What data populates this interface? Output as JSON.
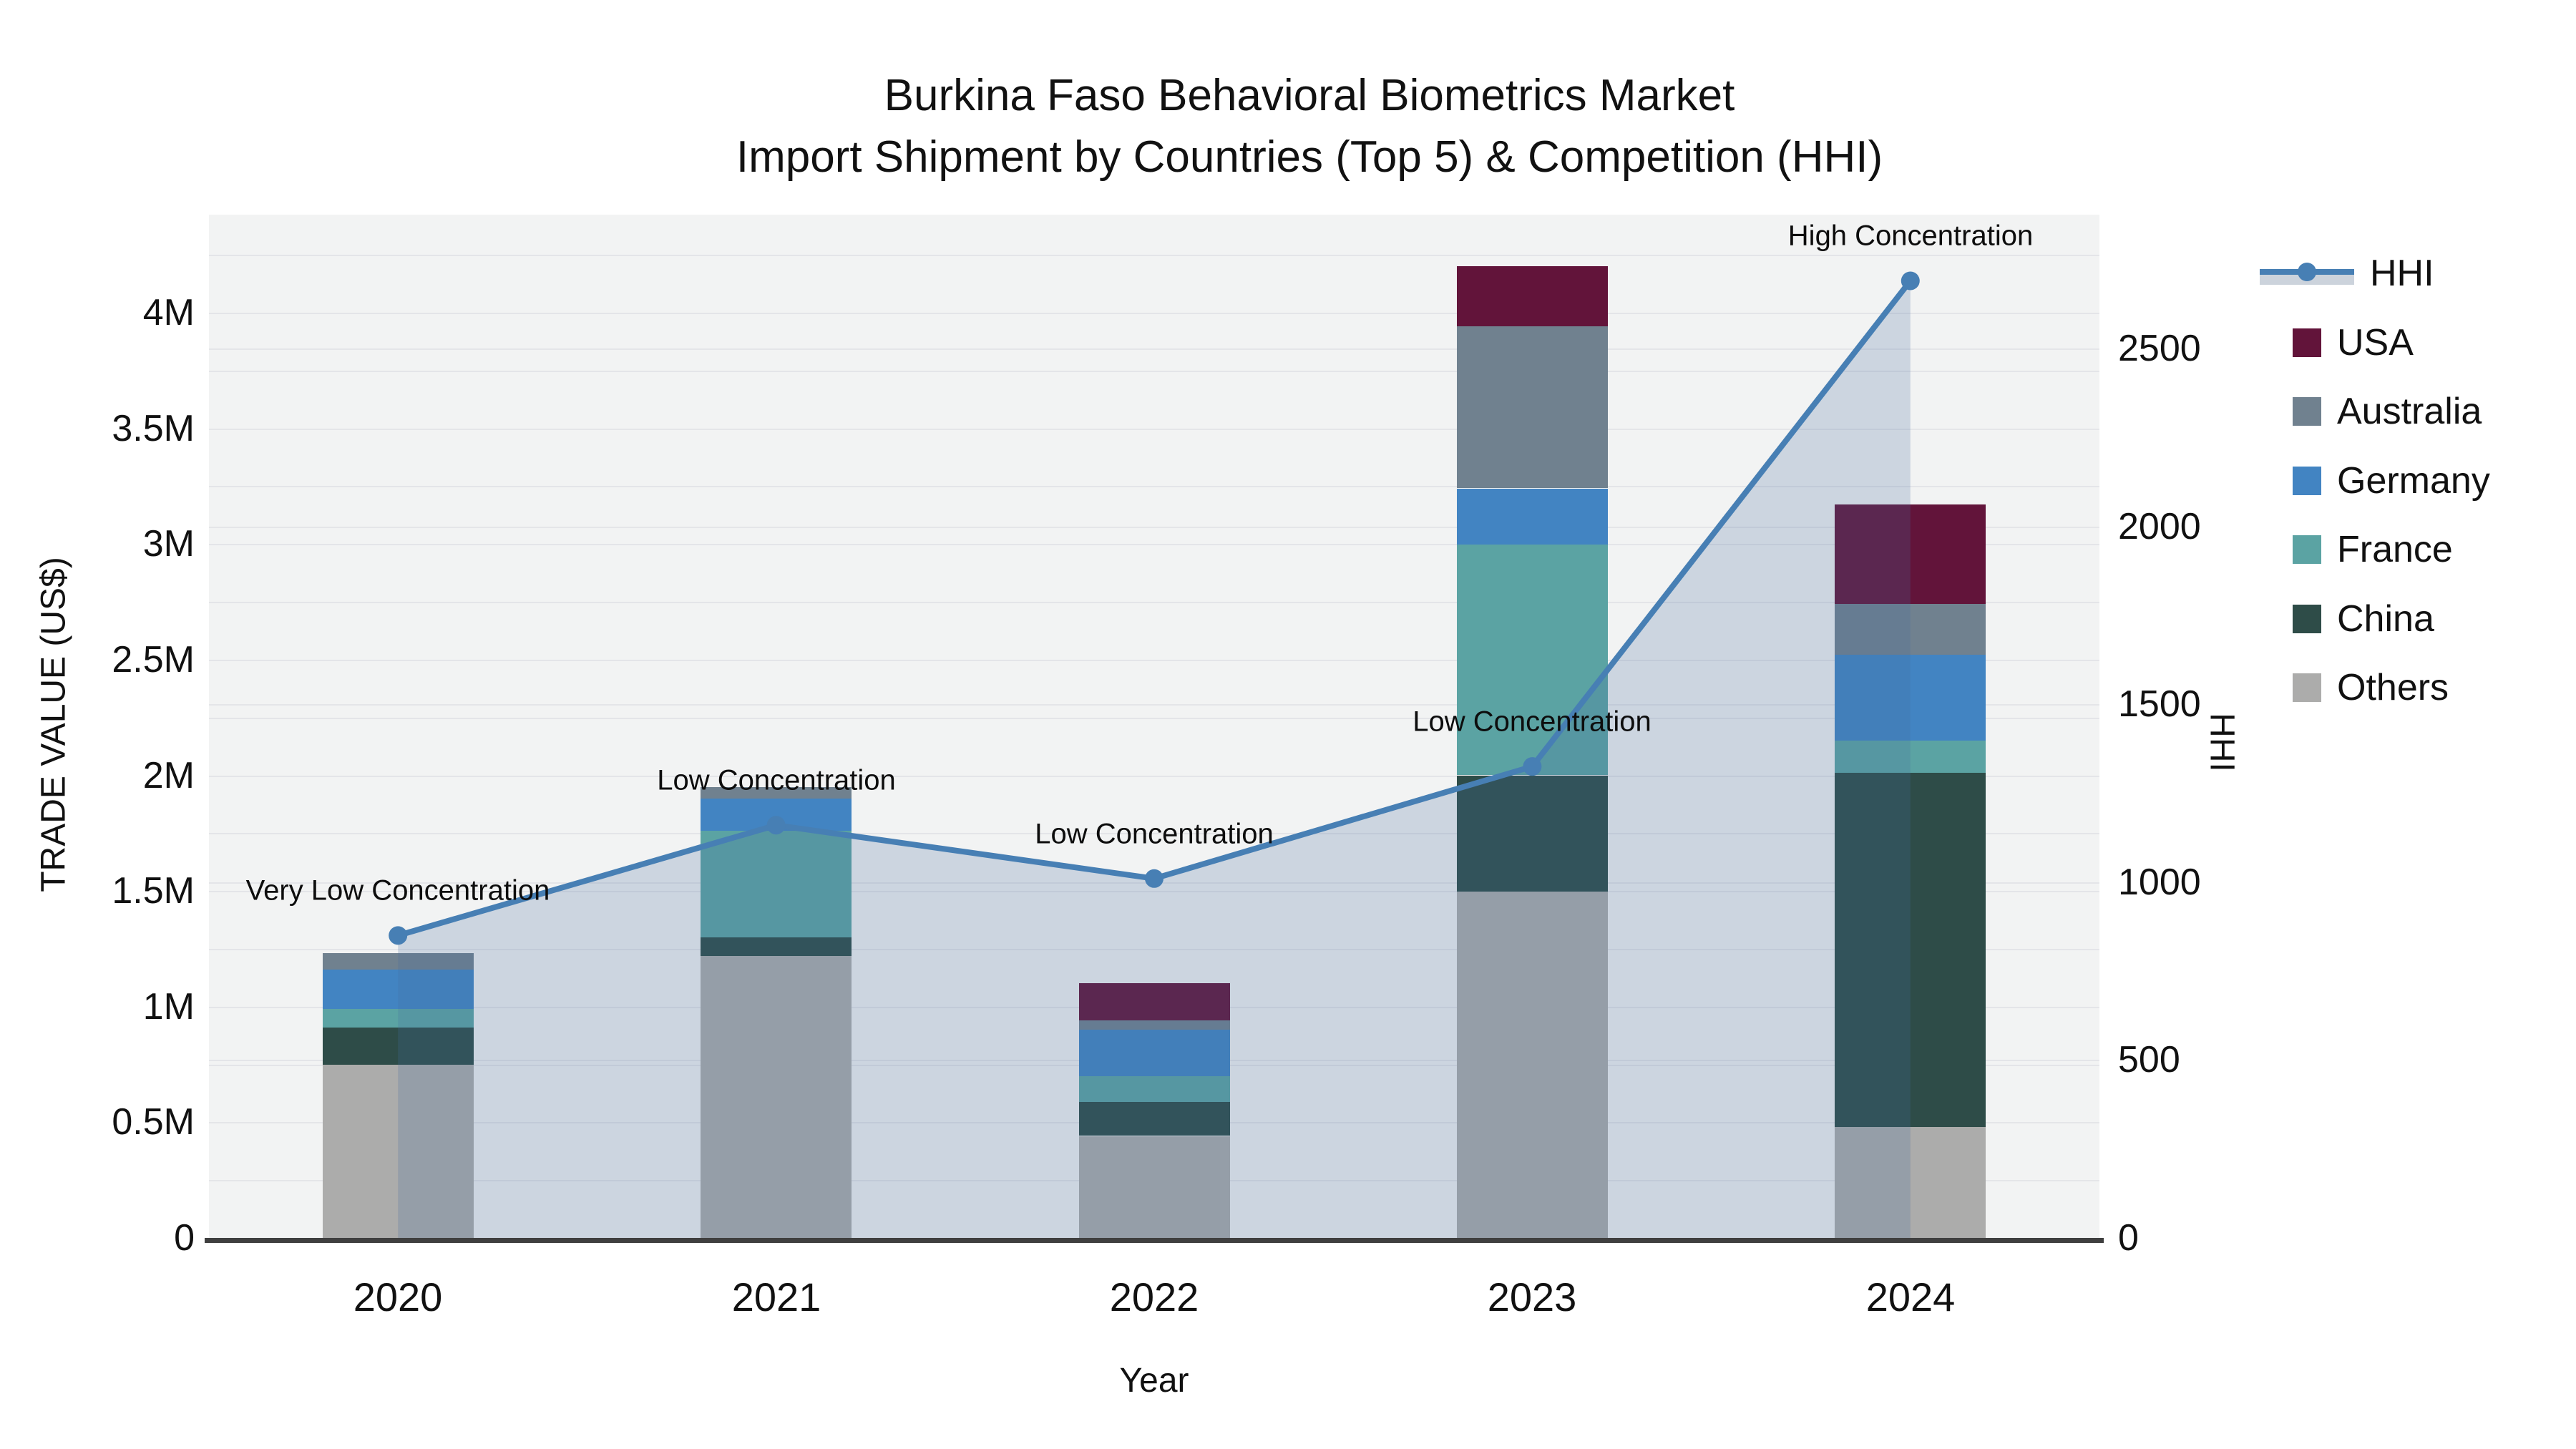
{
  "title_line1": "Burkina Faso Behavioral Biometrics Market",
  "title_line2": "Import Shipment by Countries (Top 5) & Competition (HHI)",
  "axes": {
    "x": {
      "title": "Year"
    },
    "y_left": {
      "title": "TRADE VALUE (US$)",
      "ticks": [
        "0",
        "0.5M",
        "1M",
        "1.5M",
        "2M",
        "2.5M",
        "3M",
        "3.5M",
        "4M"
      ],
      "tick_values_millions": [
        0,
        0.5,
        1,
        1.5,
        2,
        2.5,
        3,
        3.5,
        4
      ]
    },
    "y_right": {
      "title": "HHI",
      "ticks": [
        "0",
        "500",
        "1000",
        "1500",
        "2000",
        "2500"
      ],
      "tick_values": [
        0,
        500,
        1000,
        1500,
        2000,
        2500
      ]
    }
  },
  "legend": [
    {
      "label": "HHI",
      "type": "line",
      "color": "#477fb4"
    },
    {
      "label": "USA",
      "type": "swatch",
      "color": "#62143a"
    },
    {
      "label": "Australia",
      "type": "swatch",
      "color": "#70818f"
    },
    {
      "label": "Germany",
      "type": "swatch",
      "color": "#4284c2"
    },
    {
      "label": "France",
      "type": "swatch",
      "color": "#5ba3a3"
    },
    {
      "label": "China",
      "type": "swatch",
      "color": "#2e4c48"
    },
    {
      "label": "Others",
      "type": "swatch",
      "color": "#acacab"
    }
  ],
  "chart_data": {
    "type": "bar",
    "subtype": "stacked-bar-with-line-area",
    "categories": [
      "2020",
      "2021",
      "2022",
      "2023",
      "2024"
    ],
    "bar_value_unit": "trade value, US$ millions",
    "stack_order_bottom_to_top": [
      "Others",
      "China",
      "France",
      "Germany",
      "Australia",
      "USA"
    ],
    "series": [
      {
        "name": "USA",
        "color": "#62143a",
        "values": [
          0,
          0,
          0.16,
          0.26,
          0.43
        ]
      },
      {
        "name": "Australia",
        "color": "#70818f",
        "values": [
          0.07,
          0.05,
          0.04,
          0.7,
          0.22
        ]
      },
      {
        "name": "Germany",
        "color": "#4284c2",
        "values": [
          0.17,
          0.14,
          0.2,
          0.24,
          0.37
        ]
      },
      {
        "name": "France",
        "color": "#5ba3a3",
        "values": [
          0.08,
          0.46,
          0.11,
          1.0,
          0.14
        ]
      },
      {
        "name": "China",
        "color": "#2e4c48",
        "values": [
          0.16,
          0.08,
          0.15,
          0.5,
          1.53
        ]
      },
      {
        "name": "Others",
        "color": "#acacab",
        "values": [
          0.75,
          1.22,
          0.44,
          1.5,
          0.48
        ]
      }
    ],
    "bar_totals_millions": [
      1.23,
      1.95,
      1.1,
      4.2,
      3.17
    ],
    "line": {
      "name": "HHI",
      "color": "#477fb4",
      "area_fill_color": "rgba(70,110,160,0.22)",
      "values": [
        850,
        1160,
        1010,
        1325,
        2690
      ]
    },
    "annotations": [
      "Very Low Concentration",
      "Low Concentration",
      "Low Concentration",
      "Low Concentration",
      "High Concentration"
    ],
    "xlabel": "Year",
    "ylabel_left": "TRADE VALUE (US$)",
    "ylabel_right": "HHI",
    "ylim_left_millions": [
      0,
      4.424
    ],
    "ylim_right": [
      0,
      2876
    ],
    "grid": true,
    "minor_grid_step_millions": 0.25,
    "right_grid_step": 500,
    "legend_position": "right"
  }
}
